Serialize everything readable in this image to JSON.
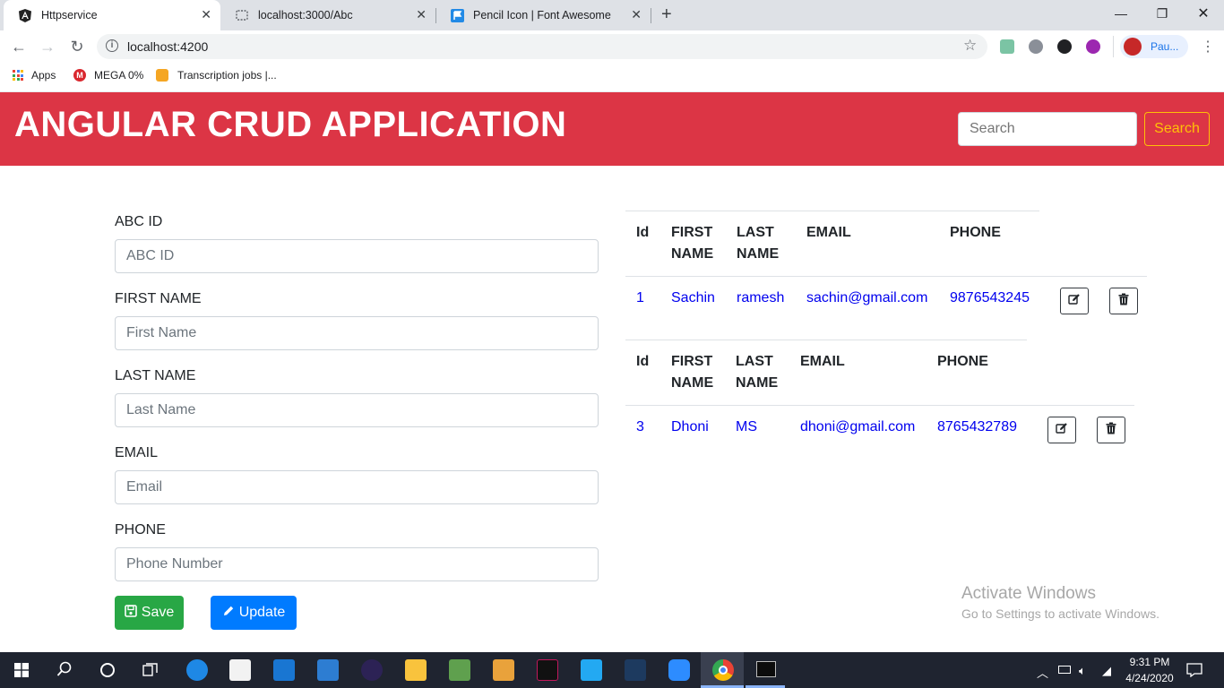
{
  "browser": {
    "tabs": [
      {
        "title": "Httpservice",
        "active": true
      },
      {
        "title": "localhost:3000/Abc",
        "active": false
      },
      {
        "title": "Pencil Icon | Font Awesome",
        "active": false
      }
    ],
    "new_tab": "+",
    "url": "localhost:4200",
    "profile_name": "Pau...",
    "bookmarks": [
      {
        "label": "Apps"
      },
      {
        "label": "MEGA 0%"
      },
      {
        "label": "Transcription jobs |..."
      }
    ]
  },
  "header": {
    "title": "ANGULAR CRUD APPLICATION",
    "search_placeholder": "Search",
    "search_button": "Search",
    "color": "#dc3545",
    "search_button_color": "#ffc107"
  },
  "form": {
    "fields": [
      {
        "label": "ABC ID",
        "placeholder": "ABC ID",
        "value": ""
      },
      {
        "label": "FIRST NAME",
        "placeholder": "First Name",
        "value": ""
      },
      {
        "label": "LAST NAME",
        "placeholder": "Last Name",
        "value": ""
      },
      {
        "label": "EMAIL",
        "placeholder": "Email",
        "value": ""
      },
      {
        "label": "PHONE",
        "placeholder": "Phone Number",
        "value": ""
      }
    ],
    "save_label": "Save",
    "update_label": "Update",
    "save_color": "#28a745",
    "update_color": "#007bff"
  },
  "records": [
    {
      "headers": {
        "id": "Id",
        "first_a": "FIRST",
        "first_b": "NAME",
        "last_a": "LAST",
        "last_b": "NAME",
        "email": "EMAIL",
        "phone": "PHONE"
      },
      "row": {
        "id": "1",
        "first": "Sachin",
        "last": "ramesh",
        "email": "sachin@gmail.com",
        "phone": "9876543245"
      }
    },
    {
      "headers": {
        "id": "Id",
        "first_a": "FIRST",
        "first_b": "NAME",
        "last_a": "LAST",
        "last_b": "NAME",
        "email": "EMAIL",
        "phone": "PHONE"
      },
      "row": {
        "id": "3",
        "first": "Dhoni",
        "last": "MS",
        "email": "dhoni@gmail.com",
        "phone": "8765432789"
      }
    }
  ],
  "watermark": {
    "line1": "Activate Windows",
    "line2": "Go to Settings to activate Windows."
  },
  "taskbar": {
    "time": "9:31 PM",
    "date": "4/24/2020"
  }
}
